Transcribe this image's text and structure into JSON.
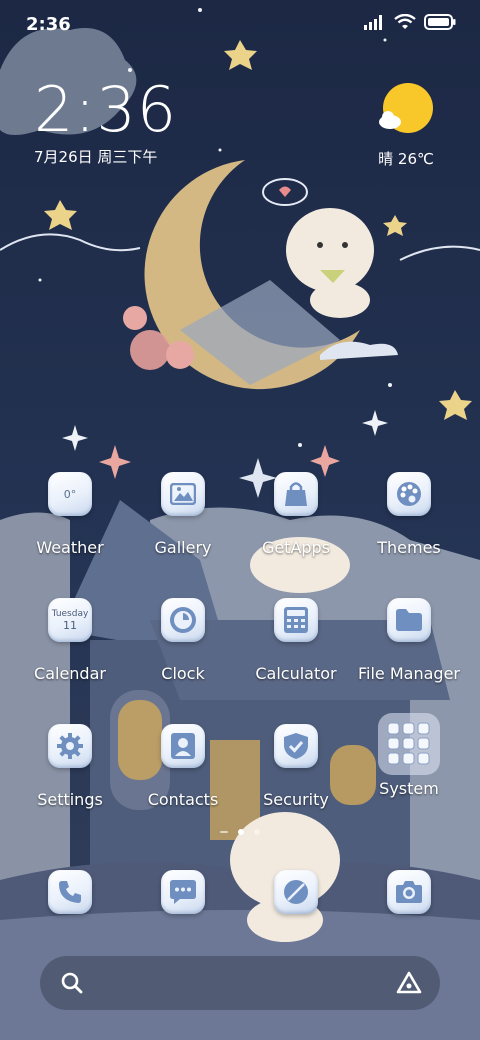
{
  "status_bar": {
    "time": "2:36",
    "icons": [
      "signal-icon",
      "wifi-icon",
      "battery-icon"
    ]
  },
  "clock_widget": {
    "time": "2:36",
    "date": "7月26日 周三下午"
  },
  "weather_widget": {
    "text": "晴 26℃",
    "icon": "sunny-icon",
    "sun_color": "#f8c72a"
  },
  "apps": [
    {
      "label": "Weather",
      "icon": "weather-icon",
      "badge": "0°"
    },
    {
      "label": "Gallery",
      "icon": "gallery-icon"
    },
    {
      "label": "GetApps",
      "icon": "shopping-bag-icon"
    },
    {
      "label": "Themes",
      "icon": "palette-icon"
    },
    {
      "label": "Calendar",
      "icon": "calendar-icon",
      "day_name": "Tuesday",
      "day_num": "11"
    },
    {
      "label": "Clock",
      "icon": "clock-icon"
    },
    {
      "label": "Calculator",
      "icon": "calculator-icon"
    },
    {
      "label": "File Manager",
      "icon": "folder-icon"
    },
    {
      "label": "Settings",
      "icon": "gear-icon"
    },
    {
      "label": "Contacts",
      "icon": "contact-icon"
    },
    {
      "label": "Security",
      "icon": "shield-icon"
    },
    {
      "label": "System",
      "icon": "app-folder-icon"
    }
  ],
  "dock": [
    {
      "icon": "phone-icon"
    },
    {
      "icon": "message-icon"
    },
    {
      "icon": "browser-icon"
    },
    {
      "icon": "camera-icon"
    }
  ],
  "pager": {
    "pages": 2,
    "active": 0
  },
  "search_bar": {
    "left_icon": "search-icon",
    "right_icon": "assistant-icon"
  },
  "colors": {
    "sky": "#1c2a46",
    "icon_glyph": "#6f8fc0",
    "moon": "#e8c98a"
  }
}
